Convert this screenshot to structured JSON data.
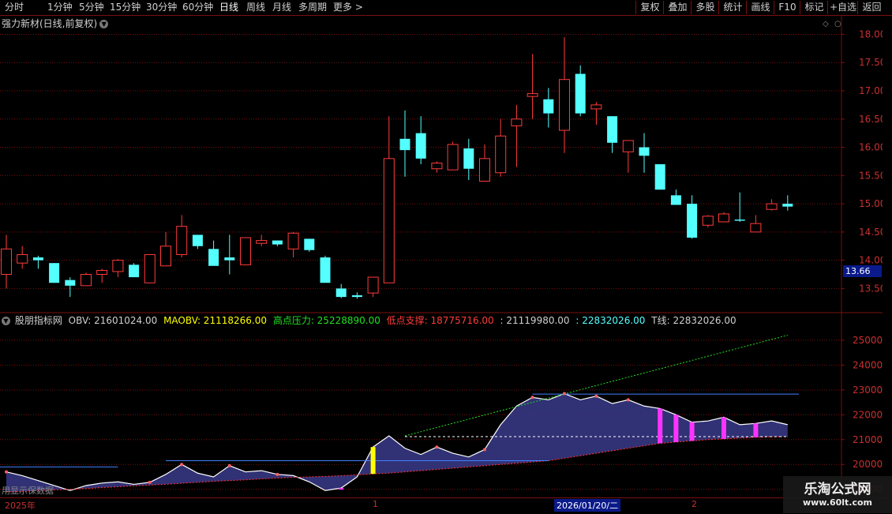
{
  "toolbar": {
    "periods": [
      "分时",
      "1分钟",
      "5分钟",
      "15分钟",
      "30分钟",
      "60分钟",
      "日线",
      "周线",
      "月线",
      "多周期",
      "更多"
    ],
    "active_period": "日线",
    "right_buttons": [
      "复权",
      "叠加",
      "多股",
      "统计",
      "画线",
      "F10",
      "标记",
      "+自选",
      "返回"
    ]
  },
  "stock": {
    "title": "强力新材(日线,前复权)",
    "current_price_label": "13.66"
  },
  "indicator": {
    "name": "股朋指标网",
    "obv": "OBV: 21601024.00",
    "maobv": "MAOBV: 21118266.00",
    "high_pressure": "高点压力: 25228890.00",
    "low_support": "低点支撑: 18775716.00",
    "v1": ": 21119980.00",
    "v2": ": 22832026.00",
    "tline": "T线: 22832026.00"
  },
  "dates": {
    "year_label": "2025年",
    "m1": "1",
    "highlight": "2026/01/20/二",
    "m2": "2"
  },
  "overlay_text": "用显示保数据",
  "watermark": {
    "title": "乐淘公式网",
    "url": "www.60lt.com"
  },
  "colors": {
    "up": "#ff3b3b",
    "down": "#54ffff",
    "grid": "#7a1010",
    "axis_text": "#c83030",
    "obv_fill": "#3a3a8a",
    "obv_fill_dark": "#5a2020"
  },
  "chart_data": [
    {
      "type": "candlestick",
      "ylim": [
        13.1,
        18.3
      ],
      "y_ticks": [
        13.5,
        14.0,
        14.5,
        15.0,
        15.5,
        16.0,
        16.5,
        17.0,
        17.5,
        18.0
      ],
      "y_tick_labels": [
        "13.50",
        "14.00",
        "14.50",
        "15.00",
        "15.50",
        "16.00",
        "16.50",
        "17.00",
        "17.50",
        "18.00"
      ],
      "candles": [
        {
          "o": 13.75,
          "h": 14.45,
          "l": 13.5,
          "c": 14.2
        },
        {
          "o": 13.95,
          "h": 14.25,
          "l": 13.85,
          "c": 14.1
        },
        {
          "o": 14.05,
          "h": 14.08,
          "l": 13.85,
          "c": 14.0
        },
        {
          "o": 13.95,
          "h": 13.95,
          "l": 13.6,
          "c": 13.6
        },
        {
          "o": 13.65,
          "h": 13.7,
          "l": 13.35,
          "c": 13.55
        },
        {
          "o": 13.55,
          "h": 13.78,
          "l": 13.55,
          "c": 13.75
        },
        {
          "o": 13.75,
          "h": 13.85,
          "l": 13.6,
          "c": 13.82
        },
        {
          "o": 13.8,
          "h": 14.02,
          "l": 13.7,
          "c": 14.0
        },
        {
          "o": 13.92,
          "h": 13.95,
          "l": 13.7,
          "c": 13.7
        },
        {
          "o": 13.6,
          "h": 14.05,
          "l": 13.6,
          "c": 14.1
        },
        {
          "o": 13.9,
          "h": 14.5,
          "l": 13.9,
          "c": 14.25
        },
        {
          "o": 14.1,
          "h": 14.8,
          "l": 14.05,
          "c": 14.6
        },
        {
          "o": 14.45,
          "h": 14.45,
          "l": 14.2,
          "c": 14.25
        },
        {
          "o": 14.2,
          "h": 14.35,
          "l": 13.92,
          "c": 13.9
        },
        {
          "o": 14.05,
          "h": 14.45,
          "l": 13.75,
          "c": 14.0
        },
        {
          "o": 13.92,
          "h": 14.4,
          "l": 13.92,
          "c": 14.4
        },
        {
          "o": 14.3,
          "h": 14.45,
          "l": 14.25,
          "c": 14.35
        },
        {
          "o": 14.35,
          "h": 14.35,
          "l": 14.25,
          "c": 14.28
        },
        {
          "o": 14.2,
          "h": 14.5,
          "l": 14.05,
          "c": 14.48
        },
        {
          "o": 14.38,
          "h": 14.38,
          "l": 14.15,
          "c": 14.18
        },
        {
          "o": 14.05,
          "h": 14.08,
          "l": 13.62,
          "c": 13.6
        },
        {
          "o": 13.5,
          "h": 13.58,
          "l": 13.33,
          "c": 13.35
        },
        {
          "o": 13.38,
          "h": 13.43,
          "l": 13.32,
          "c": 13.35
        },
        {
          "o": 13.42,
          "h": 13.7,
          "l": 13.35,
          "c": 13.7
        },
        {
          "o": 13.6,
          "h": 16.55,
          "l": 13.6,
          "c": 15.8
        },
        {
          "o": 16.15,
          "h": 16.65,
          "l": 15.48,
          "c": 15.95
        },
        {
          "o": 16.25,
          "h": 16.55,
          "l": 15.7,
          "c": 15.8
        },
        {
          "o": 15.62,
          "h": 15.75,
          "l": 15.55,
          "c": 15.72
        },
        {
          "o": 15.6,
          "h": 16.1,
          "l": 15.6,
          "c": 16.05
        },
        {
          "o": 15.98,
          "h": 16.15,
          "l": 15.42,
          "c": 15.62
        },
        {
          "o": 15.4,
          "h": 16.05,
          "l": 15.4,
          "c": 15.8
        },
        {
          "o": 15.55,
          "h": 16.5,
          "l": 15.48,
          "c": 16.2
        },
        {
          "o": 16.38,
          "h": 16.75,
          "l": 15.65,
          "c": 16.5
        },
        {
          "o": 16.9,
          "h": 17.65,
          "l": 16.5,
          "c": 16.95
        },
        {
          "o": 16.85,
          "h": 17.05,
          "l": 16.35,
          "c": 16.6
        },
        {
          "o": 16.3,
          "h": 17.95,
          "l": 15.9,
          "c": 17.2
        },
        {
          "o": 17.3,
          "h": 17.45,
          "l": 16.55,
          "c": 16.6
        },
        {
          "o": 16.68,
          "h": 16.8,
          "l": 16.4,
          "c": 16.75
        },
        {
          "o": 16.55,
          "h": 16.55,
          "l": 15.9,
          "c": 16.08
        },
        {
          "o": 15.92,
          "h": 16.1,
          "l": 15.55,
          "c": 16.12
        },
        {
          "o": 16.0,
          "h": 16.25,
          "l": 15.55,
          "c": 15.85
        },
        {
          "o": 15.7,
          "h": 15.7,
          "l": 15.25,
          "c": 15.25
        },
        {
          "o": 15.15,
          "h": 15.25,
          "l": 14.98,
          "c": 14.98
        },
        {
          "o": 15.0,
          "h": 15.15,
          "l": 14.38,
          "c": 14.4
        },
        {
          "o": 14.62,
          "h": 14.8,
          "l": 14.58,
          "c": 14.78
        },
        {
          "o": 14.68,
          "h": 14.85,
          "l": 14.68,
          "c": 14.82
        },
        {
          "o": 14.72,
          "h": 15.2,
          "l": 14.68,
          "c": 14.7
        },
        {
          "o": 14.5,
          "h": 14.8,
          "l": 14.5,
          "c": 14.65
        },
        {
          "o": 14.9,
          "h": 15.08,
          "l": 14.88,
          "c": 15.0
        },
        {
          "o": 15.0,
          "h": 15.15,
          "l": 14.88,
          "c": 14.95
        }
      ]
    },
    {
      "type": "area",
      "ylim": [
        18800000,
        25600000
      ],
      "y_ticks": [
        19000000,
        20000000,
        21000000,
        22000000,
        23000000,
        24000000,
        25000000
      ],
      "y_tick_labels": [
        "19000",
        "20000",
        "21000",
        "22000",
        "23000",
        "24000",
        "25000"
      ],
      "obv": [
        19700000,
        19550000,
        19350000,
        19150000,
        18950000,
        19150000,
        19250000,
        19300000,
        19200000,
        19280000,
        19600000,
        20000000,
        19650000,
        19500000,
        19950000,
        19700000,
        19750000,
        19600000,
        19550000,
        19300000,
        18950000,
        19050000,
        19500000,
        20700000,
        21150000,
        20650000,
        20400000,
        20700000,
        20450000,
        20300000,
        20600000,
        21600000,
        22350000,
        22700000,
        22600000,
        22850000,
        22600000,
        22750000,
        22450000,
        22600000,
        22350000,
        22250000,
        22000000,
        21700000,
        21750000,
        21900000,
        21600000,
        21650000,
        21750000,
        21600000
      ],
      "support": [
        18900000,
        18920000,
        18950000,
        18980000,
        19000000,
        19030000,
        19070000,
        19100000,
        19140000,
        19170000,
        19200000,
        19240000,
        19280000,
        19320000,
        19350000,
        19380000,
        19420000,
        19450000,
        19480000,
        19500000,
        19520000,
        19550000,
        19580000,
        19620000,
        19650000,
        19700000,
        19750000,
        19800000,
        19850000,
        19900000,
        19950000,
        20000000,
        20050000,
        20100000,
        20150000,
        20250000,
        20350000,
        20450000,
        20550000,
        20650000,
        20750000,
        20850000,
        20900000,
        20950000,
        21000000,
        21030000,
        21060000,
        21090000,
        21110000,
        21120000
      ],
      "resistance_line_y": 22832026,
      "dashed_line_y": 21119980
    }
  ]
}
